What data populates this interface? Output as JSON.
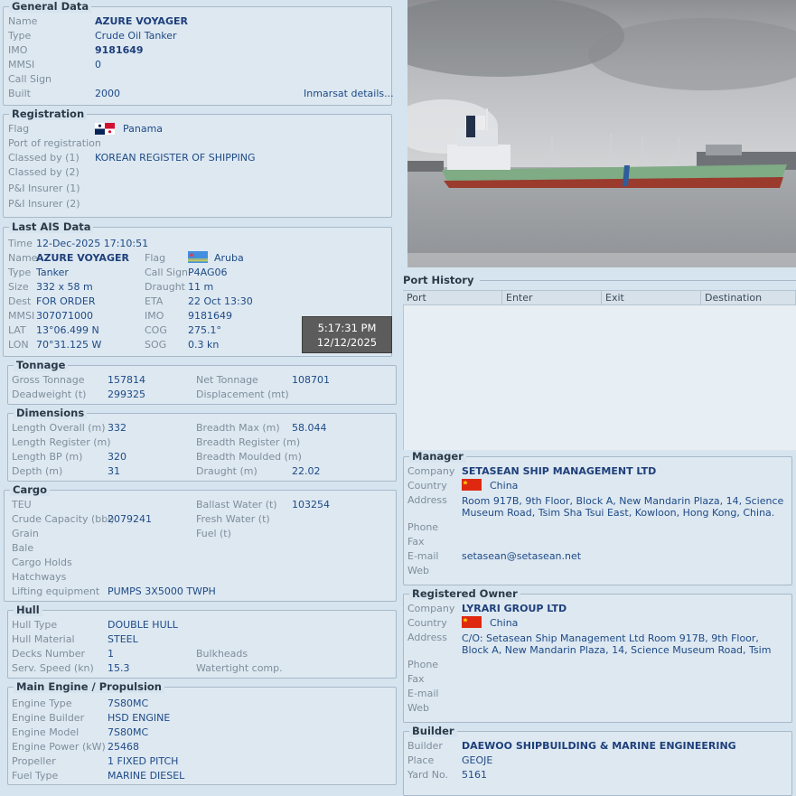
{
  "general": {
    "title": "General Data",
    "rows": [
      {
        "label": "Name",
        "value": "AZURE VOYAGER"
      },
      {
        "label": "Type",
        "value": "Crude Oil Tanker"
      },
      {
        "label": "IMO",
        "value": "9181649"
      },
      {
        "label": "MMSI",
        "value": "0"
      },
      {
        "label": "Call Sign",
        "value": ""
      },
      {
        "label": "Built",
        "value": "2000"
      }
    ],
    "inmarsat_link": "Inmarsat details..."
  },
  "registration": {
    "title": "Registration",
    "rows": [
      {
        "label": "Flag",
        "value": "Panama"
      },
      {
        "label": "Port of registration",
        "value": ""
      },
      {
        "label": "Classed by (1)",
        "value": "KOREAN REGISTER OF SHIPPING"
      },
      {
        "label": "Classed by (2)",
        "value": ""
      },
      {
        "label": "P&I Insurer (1)",
        "value": ""
      },
      {
        "label": "P&I Insurer (2)",
        "value": ""
      }
    ]
  },
  "ais": {
    "title": "Last AIS Data",
    "time_label": "Time",
    "time": "12-Dec-2025 17:10:51",
    "left": [
      {
        "label": "Name",
        "value": "AZURE VOYAGER"
      },
      {
        "label": "Type",
        "value": "Tanker"
      },
      {
        "label": "Size",
        "value": "332 x 58 m"
      },
      {
        "label": "Dest",
        "value": "FOR ORDER"
      },
      {
        "label": "MMSI",
        "value": "307071000"
      },
      {
        "label": "LAT",
        "value": "13°06.499 N"
      },
      {
        "label": "LON",
        "value": "70°31.125 W"
      }
    ],
    "right": [
      {
        "label": "Flag",
        "value": "Aruba"
      },
      {
        "label": "Call Sign",
        "value": "P4AG06"
      },
      {
        "label": "Draught",
        "value": "11 m"
      },
      {
        "label": "ETA",
        "value": "22 Oct 13:30"
      },
      {
        "label": "IMO",
        "value": "9181649"
      },
      {
        "label": "COG",
        "value": "275.1°"
      },
      {
        "label": "SOG",
        "value": "0.3 kn"
      }
    ]
  },
  "tooltip": {
    "time": "5:17:31 PM",
    "date": "12/12/2025"
  },
  "tonnage": {
    "title": "Tonnage",
    "left": [
      {
        "label": "Gross Tonnage",
        "value": "157814"
      },
      {
        "label": "Deadweight (t)",
        "value": "299325"
      }
    ],
    "right": [
      {
        "label": "Net Tonnage",
        "value": "108701"
      },
      {
        "label": "Displacement (mt)",
        "value": ""
      }
    ]
  },
  "dimensions": {
    "title": "Dimensions",
    "left": [
      {
        "label": "Length Overall (m)",
        "value": "332"
      },
      {
        "label": "Length Register (m)",
        "value": ""
      },
      {
        "label": "Length BP (m)",
        "value": "320"
      },
      {
        "label": "Depth (m)",
        "value": "31"
      }
    ],
    "right": [
      {
        "label": "Breadth Max (m)",
        "value": "58.044"
      },
      {
        "label": "Breadth Register (m)",
        "value": ""
      },
      {
        "label": "Breadth Moulded (m)",
        "value": ""
      },
      {
        "label": "Draught (m)",
        "value": "22.02"
      }
    ]
  },
  "cargo": {
    "title": "Cargo",
    "left": [
      {
        "label": "TEU",
        "value": ""
      },
      {
        "label": "Crude Capacity (bbl)",
        "value": "2079241"
      },
      {
        "label": "Grain",
        "value": ""
      },
      {
        "label": "Bale",
        "value": ""
      },
      {
        "label": "Cargo Holds",
        "value": ""
      },
      {
        "label": "Hatchways",
        "value": ""
      },
      {
        "label": "Lifting equipment",
        "value": "PUMPS 3X5000 TWPH"
      }
    ],
    "right": [
      {
        "label": "Ballast Water (t)",
        "value": "103254"
      },
      {
        "label": "Fresh Water (t)",
        "value": ""
      },
      {
        "label": "Fuel (t)",
        "value": ""
      }
    ]
  },
  "hull": {
    "title": "Hull",
    "left": [
      {
        "label": "Hull Type",
        "value": "DOUBLE HULL"
      },
      {
        "label": "Hull Material",
        "value": "STEEL"
      },
      {
        "label": "Decks Number",
        "value": "1"
      },
      {
        "label": "Serv. Speed (kn)",
        "value": "15.3"
      }
    ],
    "right": [
      {
        "label": "Bulkheads",
        "value": ""
      },
      {
        "label": "Watertight comp.",
        "value": ""
      }
    ]
  },
  "engine": {
    "title": "Main Engine / Propulsion",
    "rows": [
      {
        "label": "Engine Type",
        "value": "7S80MC"
      },
      {
        "label": "Engine Builder",
        "value": "HSD ENGINE"
      },
      {
        "label": "Engine Model",
        "value": "7S80MC"
      },
      {
        "label": "Engine Power (kW)",
        "value": "25468"
      },
      {
        "label": "Propeller",
        "value": "1 FIXED PITCH"
      },
      {
        "label": "Fuel Type",
        "value": "MARINE DIESEL"
      }
    ]
  },
  "port_history": {
    "title": "Port History",
    "columns": [
      "Port",
      "Enter",
      "Exit",
      "Destination"
    ]
  },
  "manager": {
    "title": "Manager",
    "company_label": "Company",
    "company": "SETASEAN SHIP MANAGEMENT LTD",
    "country_label": "Country",
    "country": "China",
    "address_label": "Address",
    "address": "Room 917B, 9th Floor, Block A, New Mandarin Plaza, 14, Science Museum Road, Tsim Sha Tsui East, Kowloon, Hong Kong, China.",
    "phone_label": "Phone",
    "fax_label": "Fax",
    "email_label": "E-mail",
    "email": "setasean@setasean.net",
    "web_label": "Web"
  },
  "owner": {
    "title": "Registered Owner",
    "company_label": "Company",
    "company": "LYRARI GROUP LTD",
    "country_label": "Country",
    "country": "China",
    "address_label": "Address",
    "address": "C/O: Setasean Ship Management Ltd Room 917B, 9th Floor, Block A, New Mandarin Plaza, 14, Science Museum Road, Tsim Sha Tsui East, Kowloon,",
    "phone_label": "Phone",
    "fax_label": "Fax",
    "email_label": "E-mail",
    "web_label": "Web"
  },
  "builder": {
    "title": "Builder",
    "rows": [
      {
        "label": "Builder",
        "value": "DAEWOO SHIPBUILDING & MARINE ENGINEERING"
      },
      {
        "label": "Place",
        "value": "GEOJE"
      },
      {
        "label": "Yard No.",
        "value": "5161"
      }
    ]
  },
  "colors": {
    "panel": "#dde8f1",
    "value_text": "#1e4a86",
    "label_text": "#7f8e9b"
  }
}
